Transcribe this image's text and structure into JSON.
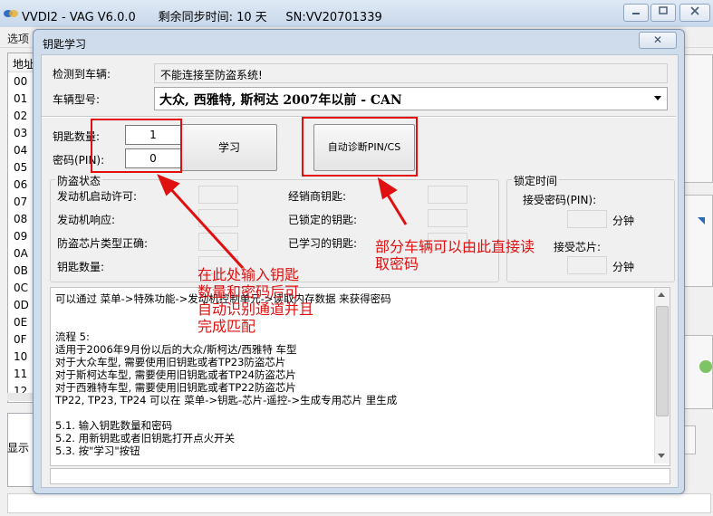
{
  "window": {
    "title": "VVDI2 - VAG V6.0.0",
    "sync_time": "剩余同步时间: 10 天",
    "serial": "SN:VV20701339",
    "minimize_icon": "minimize-icon",
    "maximize_icon": "maximize-icon",
    "close_icon": "close-icon"
  },
  "menu": {
    "options": "选项"
  },
  "left_panel": {
    "header": "地址",
    "rows": [
      "00",
      "01",
      "02",
      "03",
      "04",
      "05",
      "06",
      "07",
      "08",
      "09",
      "0A",
      "0B",
      "0C",
      "0D",
      "0E",
      "0F",
      "10",
      "11",
      "12"
    ],
    "bottom_text": "显示"
  },
  "dialog": {
    "title": "钥匙学习",
    "close_symbol": "✕",
    "vehicle_detected_label": "检测到车辆:",
    "vehicle_detected_value": "不能连接至防盗系统!",
    "model_label": "车辆型号:",
    "model_value": "大众, 西雅特, 斯柯达 2007年以前 - CAN",
    "key_count_label": "钥匙数量:",
    "key_count_value": "1",
    "pin_label": "密码(PIN):",
    "pin_value": "0",
    "learn_button": "学习",
    "auto_pin_button": "自动诊断PIN/CS",
    "immo_status": {
      "title": "防盗状态",
      "left_items": [
        "发动机启动许可:",
        "发动机响应:",
        "防盗芯片类型正确:",
        "钥匙数量:"
      ],
      "right_items": [
        "经销商钥匙:",
        "已锁定的钥匙:",
        "已学习的钥匙:"
      ]
    },
    "lock_time": {
      "title": "锁定时间",
      "accept_pin_label": "接受密码(PIN):",
      "chip_label": "接受芯片:",
      "minutes_unit": "分钟"
    },
    "log_lines": [
      "可以通过 菜单->特殊功能->发动机控制单元->读取内存数据 来获得密码",
      "",
      "流程 5:",
      "适用于2006年9月份以后的大众/斯柯达/西雅特 车型",
      "对于大众车型, 需要使用旧钥匙或者TP23防盗芯片",
      "对于斯柯达车型, 需要使用旧钥匙或者TP24防盗芯片",
      "对于西雅特车型, 需要使用旧钥匙或者TP22防盗芯片",
      "TP22, TP23, TP24 可以在 菜单->钥匙-芯片-遥控->生成专用芯片 里生成",
      "",
      "5.1. 输入钥匙数量和密码",
      "5.2. 用新钥匙或者旧钥匙打开点火开关",
      "5.3. 按\"学习\"按钮"
    ]
  },
  "annotations": {
    "note_left": [
      "在此处输入钥匙",
      "数量和密码后可",
      "自动识别通道并且",
      "完成匹配"
    ],
    "note_right": [
      "部分车辆可以由此直接读",
      "取密码"
    ],
    "color": "#e01010"
  }
}
